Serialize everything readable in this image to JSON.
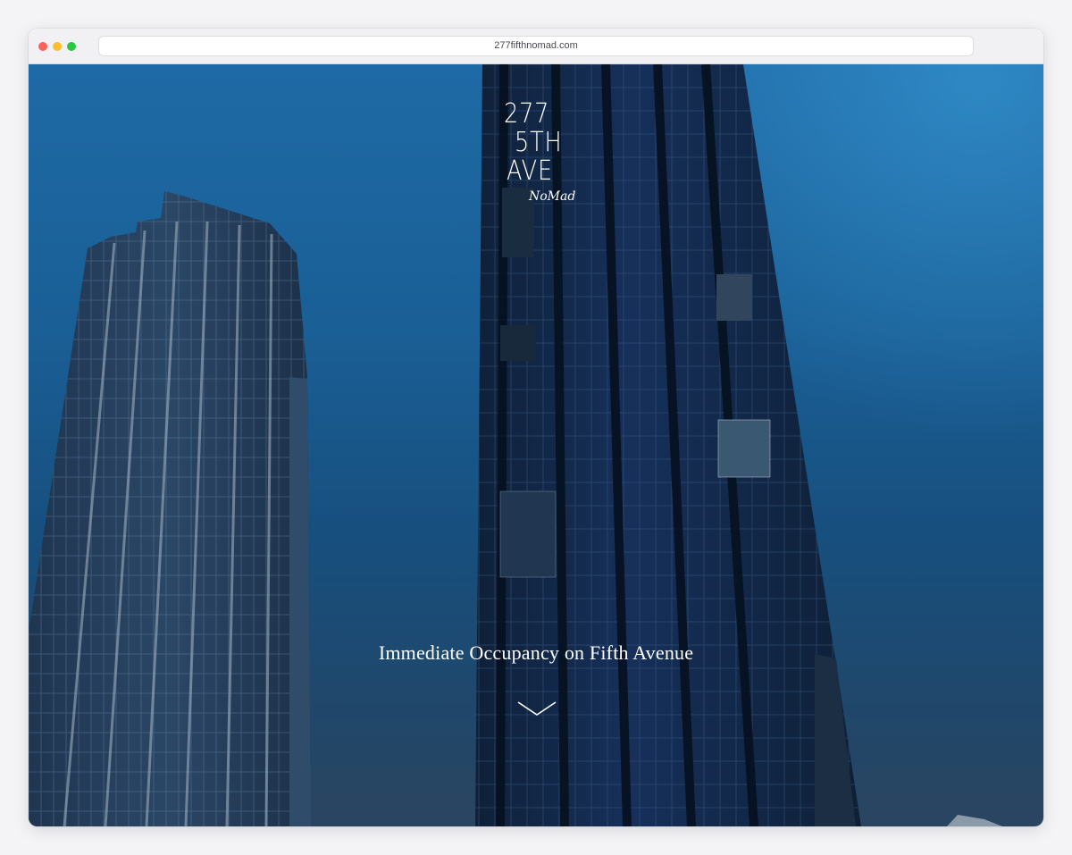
{
  "browser": {
    "url": "277fifthnomad.com"
  },
  "logo": {
    "line1": "277",
    "line2": "5TH",
    "line3": "AVE",
    "neighborhood": "NoMad"
  },
  "hero": {
    "headline": "Immediate Occupancy on Fifth Avenue",
    "scroll_icon": "chevron-down-icon"
  },
  "colors": {
    "sky_top": "#1e6aa6",
    "sky_bottom": "#2a4560",
    "text": "#ffffff"
  }
}
